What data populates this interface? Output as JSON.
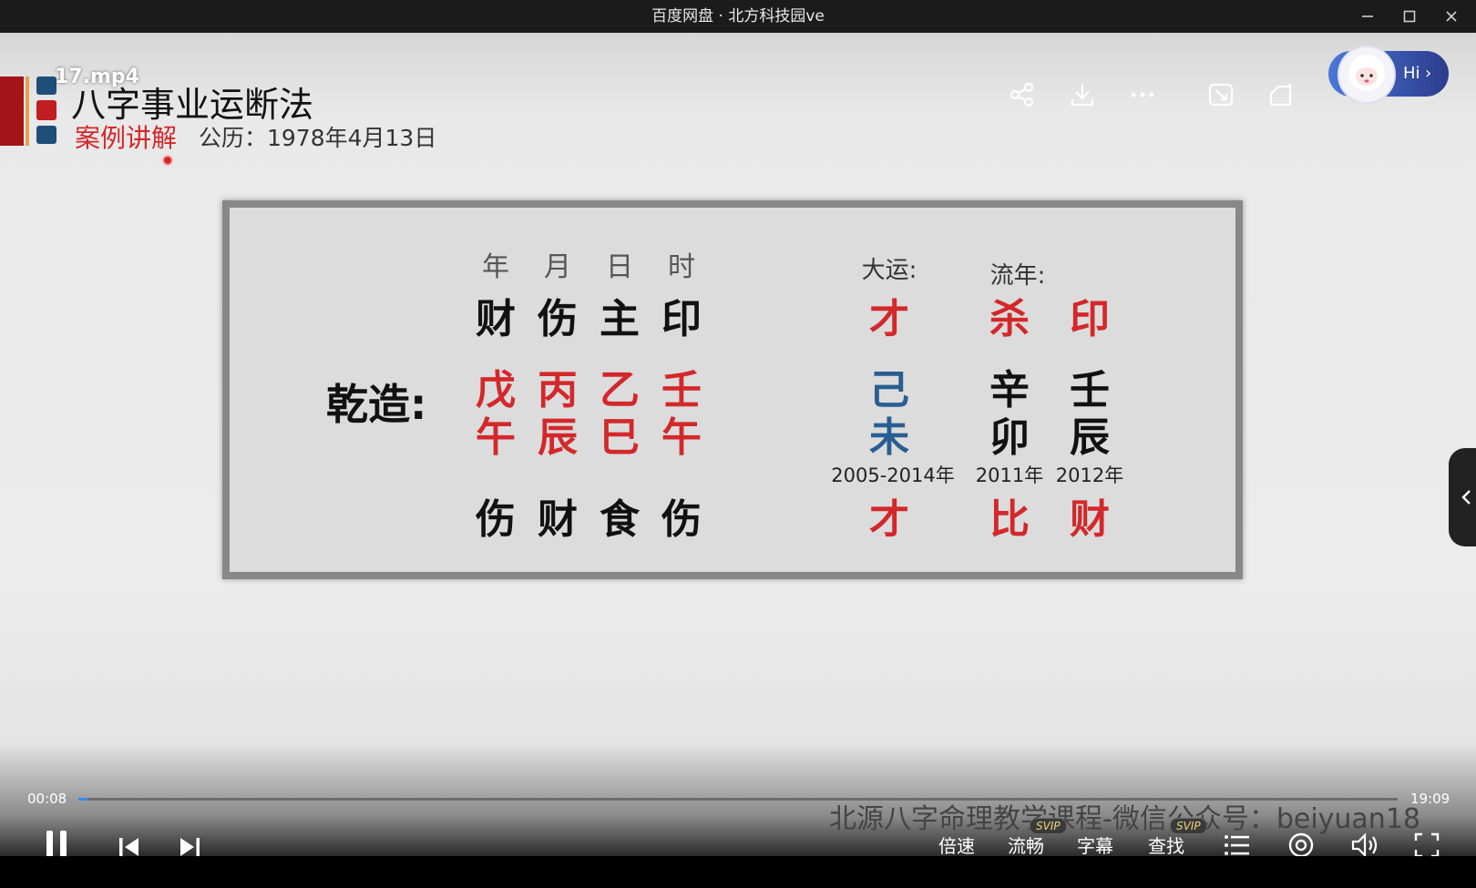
{
  "window": {
    "title": "百度网盘 · 北方科技园ve",
    "controls": {
      "minimize_icon": "minimize-icon",
      "maximize_icon": "maximize-icon",
      "close_icon": "close-icon"
    }
  },
  "video_overlay": {
    "file_name": "17.mp4",
    "course_title": "八字事业运断法",
    "case_label": "案例讲解",
    "birth_date": "公历：1978年4月13日",
    "watermark": "北源八字命理教学课程-微信公众号：beiyuan18"
  },
  "top_icons": [
    "share-icon",
    "download-icon",
    "more-icon",
    "screen-capture-icon",
    "crop-icon"
  ],
  "assistant": {
    "greeting": "Hi"
  },
  "board": {
    "column_headers": [
      "年",
      "月",
      "日",
      "时"
    ],
    "ten_gods_top": [
      "财",
      "伤",
      "主",
      "印"
    ],
    "qianzao_label": "乾造:",
    "stems": [
      "戊",
      "丙",
      "乙",
      "壬"
    ],
    "branches": [
      "午",
      "辰",
      "巳",
      "午"
    ],
    "ten_gods_bottom": [
      "伤",
      "财",
      "食",
      "伤"
    ],
    "dayun_label": "大运:",
    "liunian_label": "流年:",
    "dayun": {
      "top": "才",
      "stem": "己",
      "branch": "未",
      "years": "2005-2014年",
      "bottom": "才"
    },
    "liunian": [
      {
        "top": "杀",
        "stem": "辛",
        "branch": "卯",
        "year": "2011年",
        "bottom": "比"
      },
      {
        "top": "印",
        "stem": "壬",
        "branch": "辰",
        "year": "2012年",
        "bottom": "财"
      }
    ]
  },
  "player": {
    "current_time": "00:08",
    "total_time": "19:09",
    "progress": 0.007,
    "buttons": {
      "speed": "倍速",
      "quality": "流畅",
      "subtitles": "字幕",
      "search": "查找",
      "svip_badge": "SVIP"
    }
  },
  "colors": {
    "accent_red": "#d3282b",
    "accent_blue": "#2a5e92",
    "progress": "#2f8cff"
  }
}
